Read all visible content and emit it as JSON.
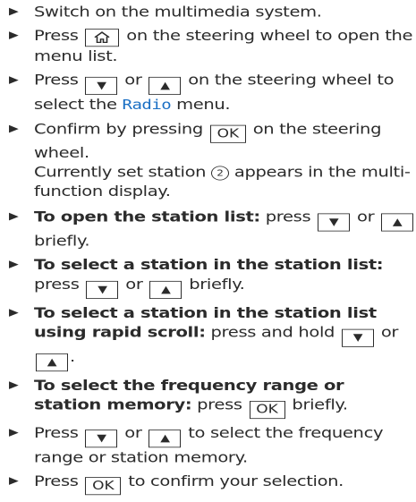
{
  "bullet": "▶",
  "keys": {
    "down": "▼",
    "up": "▲",
    "ok": "OK",
    "home": "home-icon"
  },
  "colors": {
    "menu_name": "#1a6fc4",
    "text": "#2b2b2b"
  },
  "steps": {
    "s1": {
      "text": "Switch on the multimedia system."
    },
    "s2": {
      "a": "Press",
      "b": "on the steering wheel to open the menu list."
    },
    "s3": {
      "a": "Press",
      "or": "or",
      "b": "on the steering wheel to select the",
      "menu": "Radio",
      "c": "menu."
    },
    "s4": {
      "a": "Confirm by pressing",
      "b": "on the steering wheel.",
      "note_a": "Currently set station",
      "circle": "2",
      "note_b": "appears in the multi-function display."
    },
    "s5": {
      "bold": "To open the station list:",
      "a": "press",
      "or": "or",
      "b": "briefly."
    },
    "s6": {
      "bold": "To select a station in the station list:",
      "a": "press",
      "or": "or",
      "b": "briefly."
    },
    "s7": {
      "bold": "To select a station in the station list using rapid scroll:",
      "a": "press and hold",
      "or": "or",
      "b": "."
    },
    "s8": {
      "bold": "To select the frequency range or station memory:",
      "a": "press",
      "b": "briefly."
    },
    "s9": {
      "a": "Press",
      "or": "or",
      "b": "to select the frequency range or station memory."
    },
    "s10": {
      "a": "Press",
      "b": "to confirm your selection."
    }
  }
}
